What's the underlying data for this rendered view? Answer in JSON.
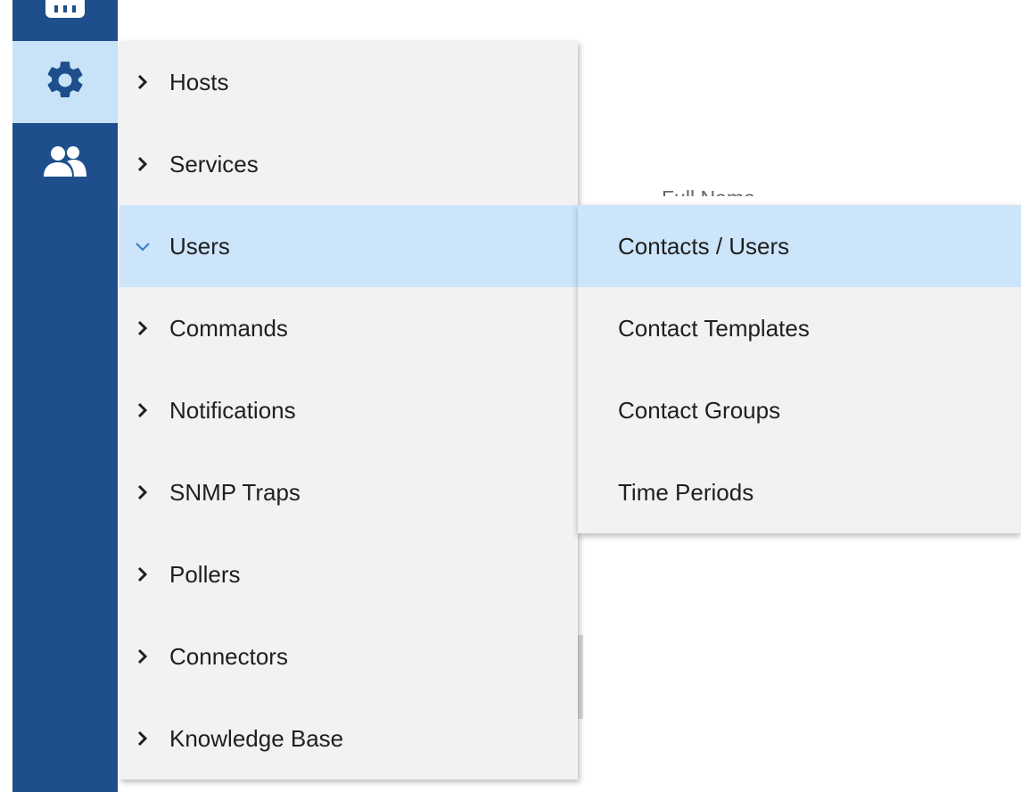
{
  "rail": {
    "items": [
      {
        "icon": "dashboard-icon"
      },
      {
        "icon": "gear-icon"
      },
      {
        "icon": "users-icon"
      }
    ],
    "bg_color": "#1e4f8c",
    "active_bg": "#c8e3f8"
  },
  "menu": {
    "items": [
      {
        "label": "Hosts",
        "expanded": false
      },
      {
        "label": "Services",
        "expanded": false
      },
      {
        "label": "Users",
        "expanded": true
      },
      {
        "label": "Commands",
        "expanded": false
      },
      {
        "label": "Notifications",
        "expanded": false
      },
      {
        "label": "SNMP Traps",
        "expanded": false
      },
      {
        "label": "Pollers",
        "expanded": false
      },
      {
        "label": "Connectors",
        "expanded": false
      },
      {
        "label": "Knowledge Base",
        "expanded": false
      }
    ]
  },
  "submenu": {
    "items": [
      {
        "label": "Contacts / Users",
        "active": true
      },
      {
        "label": "Contact Templates",
        "active": false
      },
      {
        "label": "Contact Groups",
        "active": false
      },
      {
        "label": "Time Periods",
        "active": false
      }
    ]
  },
  "background": {
    "partial_label": "Full Name"
  },
  "colors": {
    "highlight": "#cce5fa",
    "menu_bg": "#f2f2f2",
    "chevron_active": "#3d7fc9"
  }
}
